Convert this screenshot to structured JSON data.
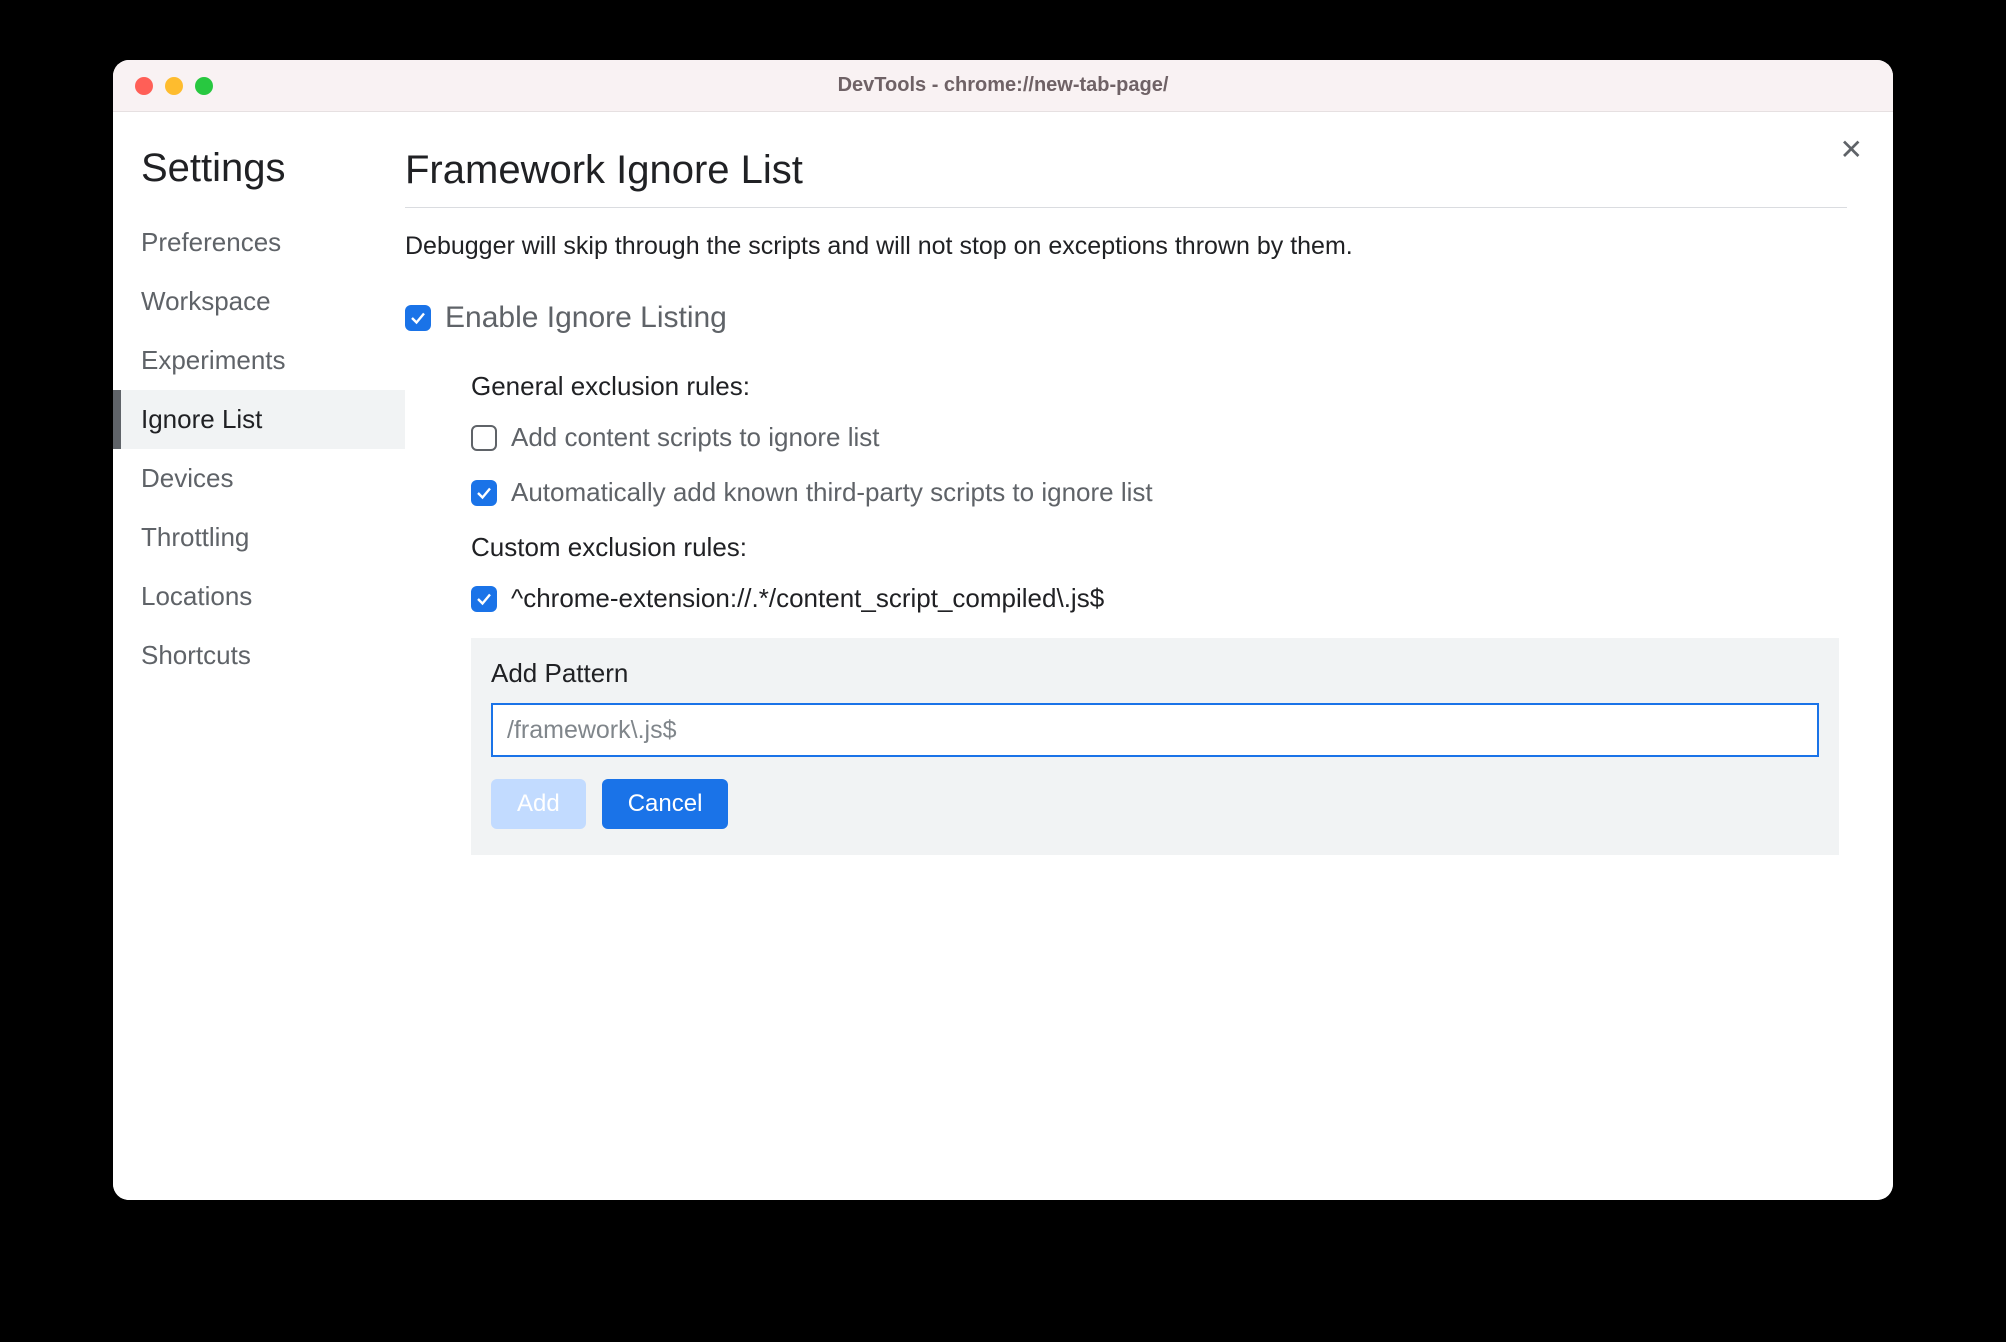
{
  "titlebar": {
    "title": "DevTools - chrome://new-tab-page/"
  },
  "sidebar": {
    "title": "Settings",
    "items": [
      {
        "label": "Preferences",
        "active": false
      },
      {
        "label": "Workspace",
        "active": false
      },
      {
        "label": "Experiments",
        "active": false
      },
      {
        "label": "Ignore List",
        "active": true
      },
      {
        "label": "Devices",
        "active": false
      },
      {
        "label": "Throttling",
        "active": false
      },
      {
        "label": "Locations",
        "active": false
      },
      {
        "label": "Shortcuts",
        "active": false
      }
    ]
  },
  "main": {
    "title": "Framework Ignore List",
    "description": "Debugger will skip through the scripts and will not stop on exceptions thrown by them.",
    "enable_label": "Enable Ignore Listing",
    "enable_checked": true,
    "general_heading": "General exclusion rules:",
    "general_rules": [
      {
        "label": "Add content scripts to ignore list",
        "checked": false
      },
      {
        "label": "Automatically add known third-party scripts to ignore list",
        "checked": true
      }
    ],
    "custom_heading": "Custom exclusion rules:",
    "custom_rules": [
      {
        "label": "^chrome-extension://.*/content_script_compiled\\.js$",
        "checked": true
      }
    ],
    "adder": {
      "label": "Add Pattern",
      "placeholder": "/framework\\.js$",
      "value": "",
      "add_label": "Add",
      "cancel_label": "Cancel"
    }
  }
}
